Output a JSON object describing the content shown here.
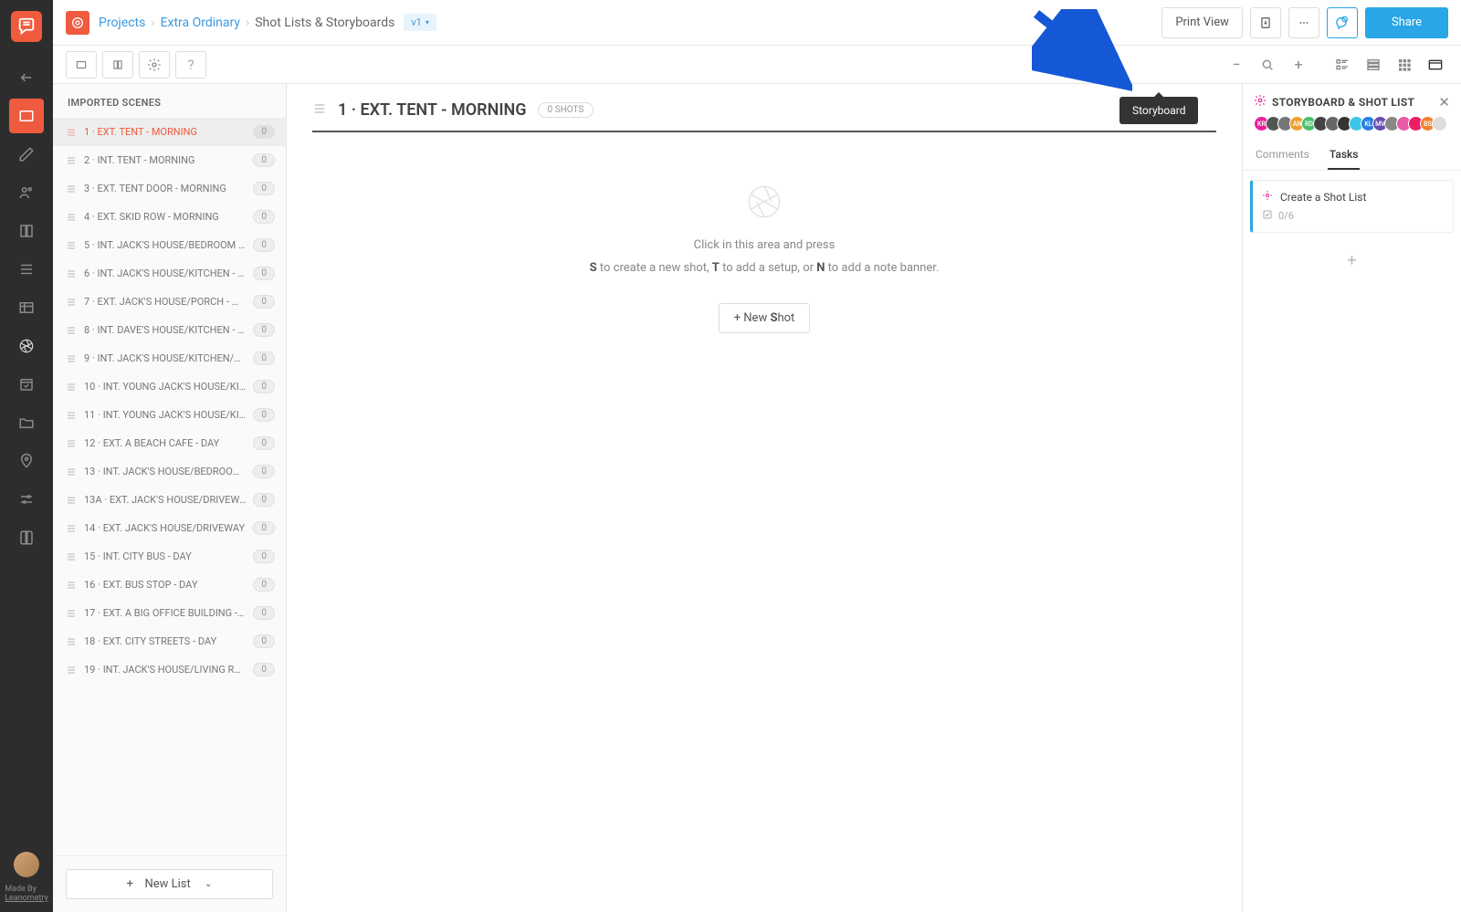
{
  "breadcrumb": {
    "projects": "Projects",
    "project": "Extra Ordinary",
    "page": "Shot Lists & Storyboards",
    "version": "v1"
  },
  "topbar": {
    "print": "Print View",
    "share": "Share"
  },
  "tooltip": "Storyboard",
  "scenes": {
    "heading": "IMPORTED SCENES",
    "newlist": "New List",
    "items": [
      {
        "label": "1 · EXT. TENT - MORNING",
        "count": "0",
        "active": true
      },
      {
        "label": "2 · INT. TENT - MORNING",
        "count": "0"
      },
      {
        "label": "3 · EXT. TENT DOOR - MORNING",
        "count": "0"
      },
      {
        "label": "4 · EXT. SKID ROW - MORNING",
        "count": "0"
      },
      {
        "label": "5 · INT. JACK'S HOUSE/BEDROOM -…",
        "count": "0"
      },
      {
        "label": "6 · INT. JACK'S HOUSE/KITCHEN - …",
        "count": "0"
      },
      {
        "label": "7 · EXT. JACK'S HOUSE/PORCH - M…",
        "count": "0"
      },
      {
        "label": "8 · INT. DAVE'S HOUSE/KITCHEN - …",
        "count": "0"
      },
      {
        "label": "9 · INT. JACK'S HOUSE/KITCHEN/TA…",
        "count": "0"
      },
      {
        "label": "10 · INT. YOUNG JACK'S HOUSE/KI…",
        "count": "0"
      },
      {
        "label": "11 · INT. YOUNG JACK'S HOUSE/KI…",
        "count": "0"
      },
      {
        "label": "12 · EXT. A BEACH CAFE - DAY",
        "count": "0"
      },
      {
        "label": "13 · INT. JACK'S HOUSE/BEDROOM…",
        "count": "0"
      },
      {
        "label": "13A · EXT. JACK'S HOUSE/DRIVEWA…",
        "count": "0"
      },
      {
        "label": "14 · EXT. JACK'S HOUSE/DRIVEWAY",
        "count": "0"
      },
      {
        "label": "15 · INT. CITY BUS - DAY",
        "count": "0"
      },
      {
        "label": "16 · EXT. BUS STOP - DAY",
        "count": "0"
      },
      {
        "label": "17 · EXT. A BIG OFFICE BUILDING - …",
        "count": "0"
      },
      {
        "label": "18 · EXT. CITY STREETS - DAY",
        "count": "0"
      },
      {
        "label": "19 · INT. JACK'S HOUSE/LIVING RO…",
        "count": "0"
      }
    ]
  },
  "canvas": {
    "title": "1 · EXT. TENT - MORNING",
    "shots_badge": "0 SHOTS",
    "empty_line1": "Click in this area and press",
    "empty_s": "S",
    "empty_s_after": " to create a new shot, ",
    "empty_t": "T",
    "empty_t_after": " to add a setup, or ",
    "empty_n": "N",
    "empty_n_after": " to add a note banner.",
    "newshot_prefix": "+  New ",
    "newshot_s": "S",
    "newshot_suffix": "hot"
  },
  "side": {
    "title": "STORYBOARD & SHOT LIST",
    "tabs": {
      "comments": "Comments",
      "tasks": "Tasks"
    },
    "task": {
      "title": "Create a Shot List",
      "progress": "0/6"
    },
    "avatars": [
      {
        "bg": "#e91e9c",
        "t": "KR"
      },
      {
        "bg": "#555",
        "t": ""
      },
      {
        "bg": "#777",
        "t": ""
      },
      {
        "bg": "#f0a030",
        "t": "AN"
      },
      {
        "bg": "#4cbf6b",
        "t": "RD"
      },
      {
        "bg": "#444",
        "t": ""
      },
      {
        "bg": "#666",
        "t": ""
      },
      {
        "bg": "#333",
        "t": ""
      },
      {
        "bg": "#3bc8e8",
        "t": ""
      },
      {
        "bg": "#2b7de0",
        "t": "KL"
      },
      {
        "bg": "#6a4caf",
        "t": "MV"
      },
      {
        "bg": "#888",
        "t": ""
      },
      {
        "bg": "#e85aa8",
        "t": ""
      },
      {
        "bg": "#e91e63",
        "t": ""
      },
      {
        "bg": "#f08030",
        "t": "BS"
      },
      {
        "bg": "#ddd",
        "t": ""
      }
    ]
  },
  "footer": {
    "made": "Made By",
    "brand": "Leanometry"
  }
}
